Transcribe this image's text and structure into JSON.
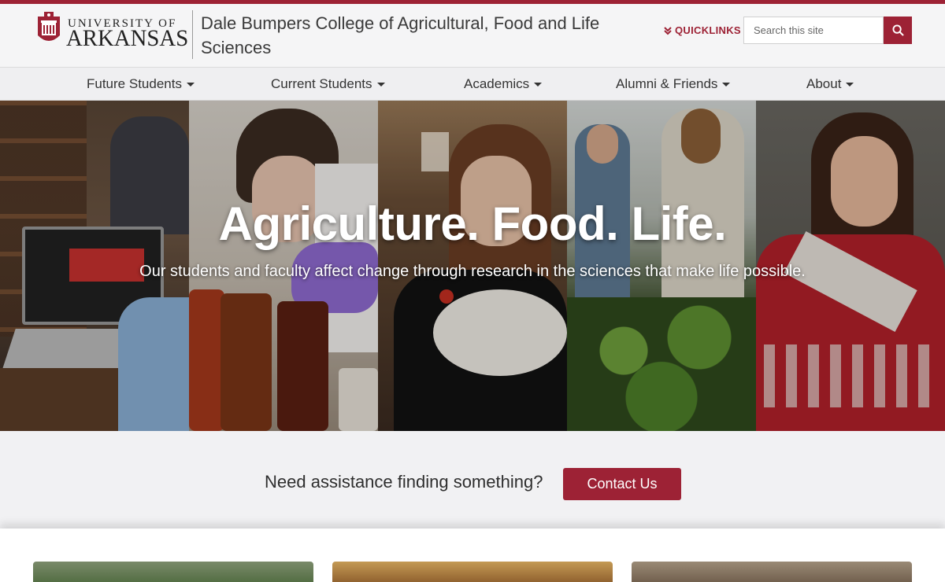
{
  "university": {
    "line1": "UNIVERSITY OF",
    "line2": "ARKANSAS"
  },
  "college_title": "Dale Bumpers College of Agricultural, Food and Life Sciences",
  "header": {
    "quicklinks_label": "QUICKLINKS",
    "search_placeholder": "Search this site"
  },
  "nav": {
    "items": [
      {
        "label": "Future Students"
      },
      {
        "label": "Current Students"
      },
      {
        "label": "Academics"
      },
      {
        "label": "Alumni & Friends"
      },
      {
        "label": "About"
      }
    ]
  },
  "hero": {
    "title": "Agriculture. Food. Life.",
    "subtitle": "Our students and faculty affect change through research in the sciences that make life possible."
  },
  "assist": {
    "text": "Need assistance finding something?",
    "button_label": "Contact Us"
  },
  "colors": {
    "brand": "#9d2235",
    "nav_bg": "#efeff1",
    "page_bg": "#f3f3f5"
  }
}
